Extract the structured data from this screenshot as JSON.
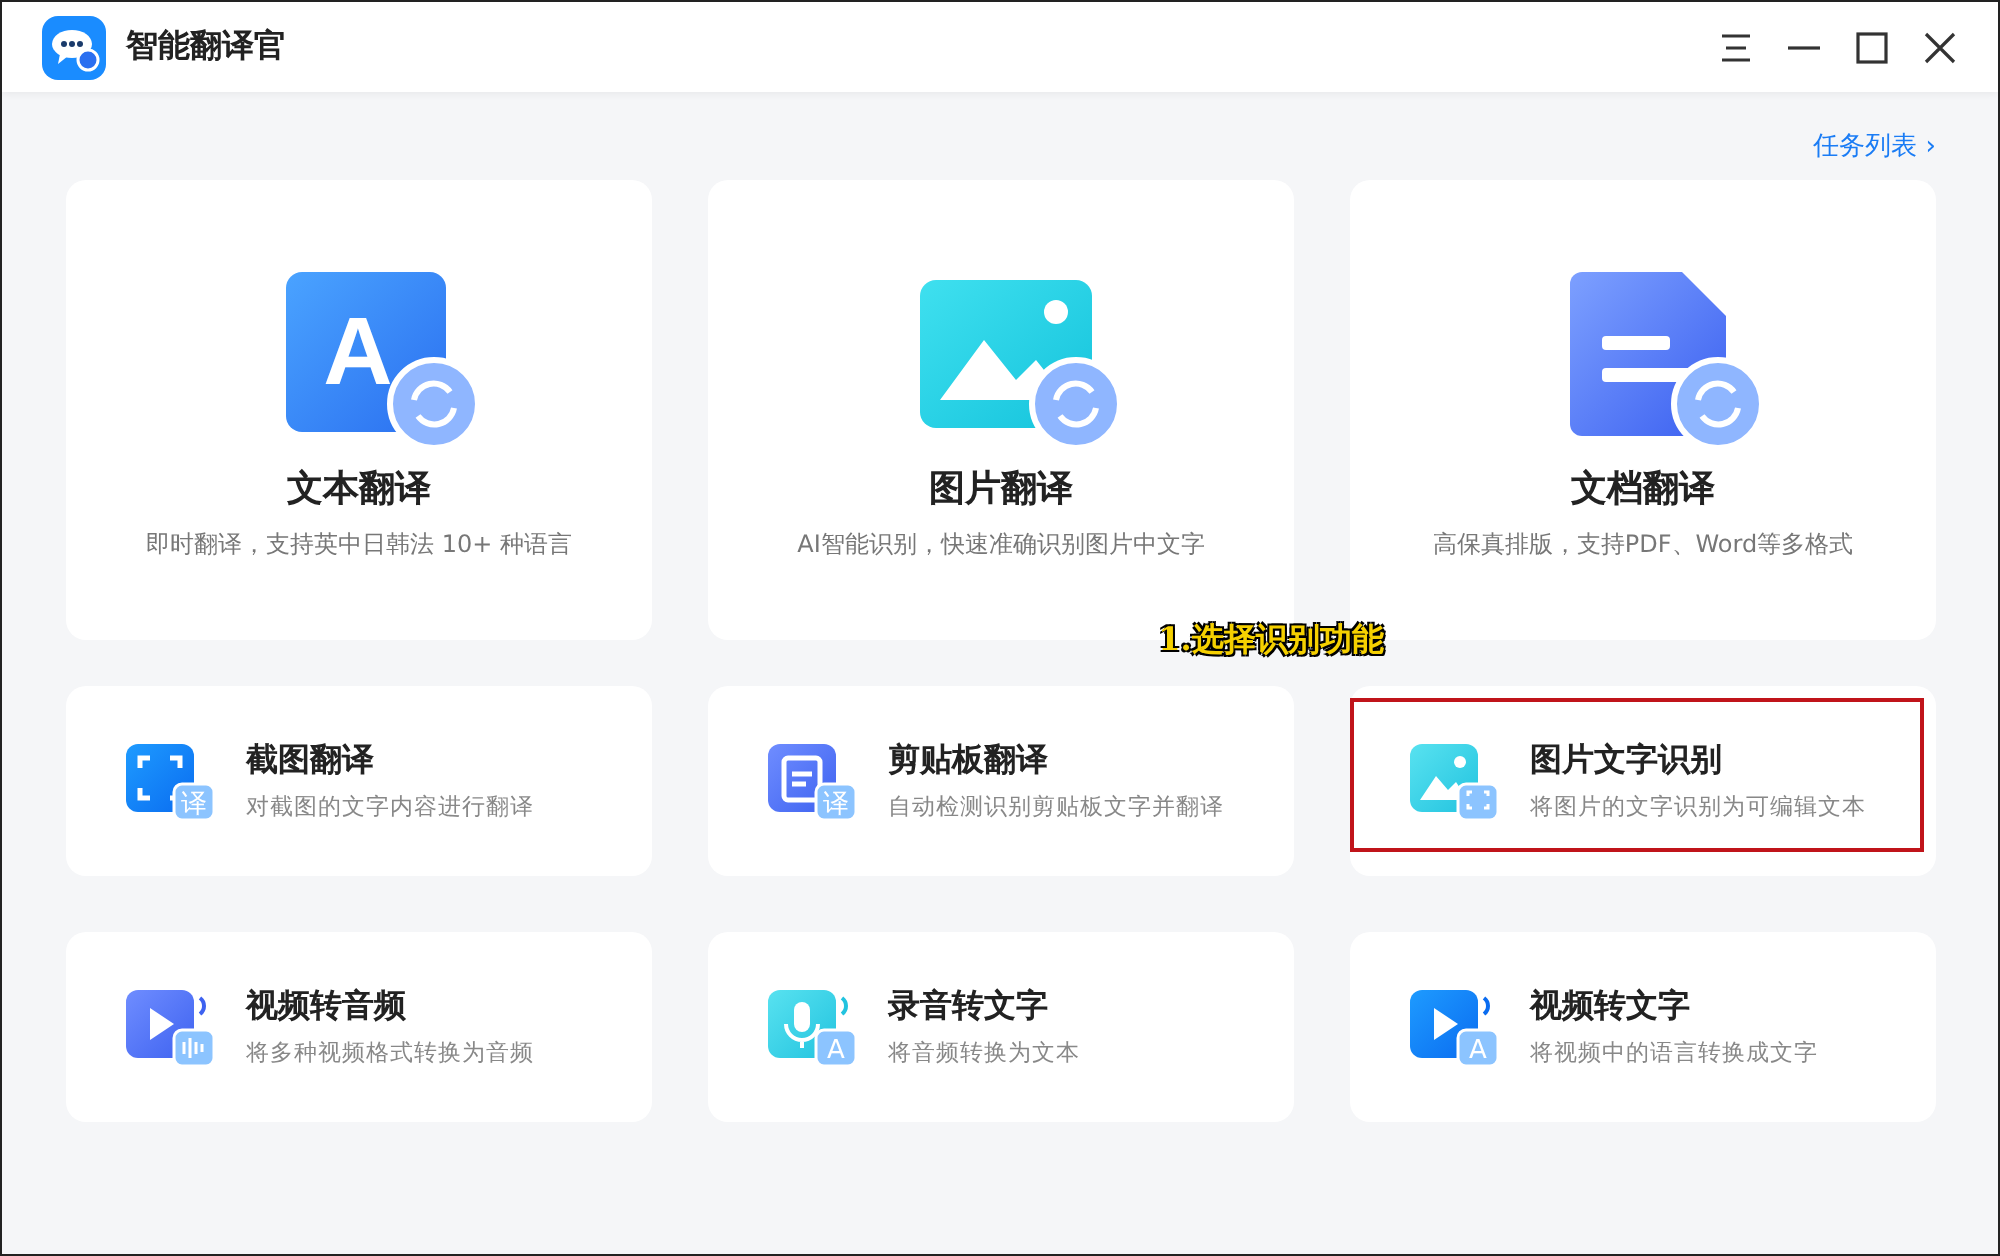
{
  "window": {
    "title": "智能翻译官"
  },
  "task_list_link": {
    "label": "任务列表",
    "chevron": "›"
  },
  "main_tools": [
    {
      "kind": "text",
      "glyph": "A",
      "title": "文本翻译",
      "description": "即时翻译，支持英中日韩法 10+ 种语言"
    },
    {
      "kind": "image",
      "title": "图片翻译",
      "description": "AI智能识别，快速准确识别图片中文字"
    },
    {
      "kind": "document",
      "title": "文档翻译",
      "description": "高保真排版，支持PDF、Word等多格式"
    }
  ],
  "annotation": "1.选择识别功能",
  "tools": [
    {
      "kind": "screenshot",
      "glyph": "译",
      "title": "截图翻译",
      "description": "对截图的文字内容进行翻译",
      "highlighted": false
    },
    {
      "kind": "clipboard",
      "glyph": "译",
      "title": "剪贴板翻译",
      "description": "自动检测识别剪贴板文字并翻译",
      "highlighted": false
    },
    {
      "kind": "ocr",
      "title": "图片文字识别",
      "description": "将图片的文字识别为可编辑文本",
      "highlighted": true
    },
    {
      "kind": "video-audio",
      "title": "视频转音频",
      "description": "将多种视频格式转换为音频",
      "highlighted": false
    },
    {
      "kind": "audio-text",
      "glyph": "A",
      "title": "录音转文字",
      "description": "将音频转换为文本",
      "highlighted": false
    },
    {
      "kind": "video-text",
      "glyph": "A",
      "title": "视频转文字",
      "description": "将视频中的语言转换成文字",
      "highlighted": false
    }
  ]
}
